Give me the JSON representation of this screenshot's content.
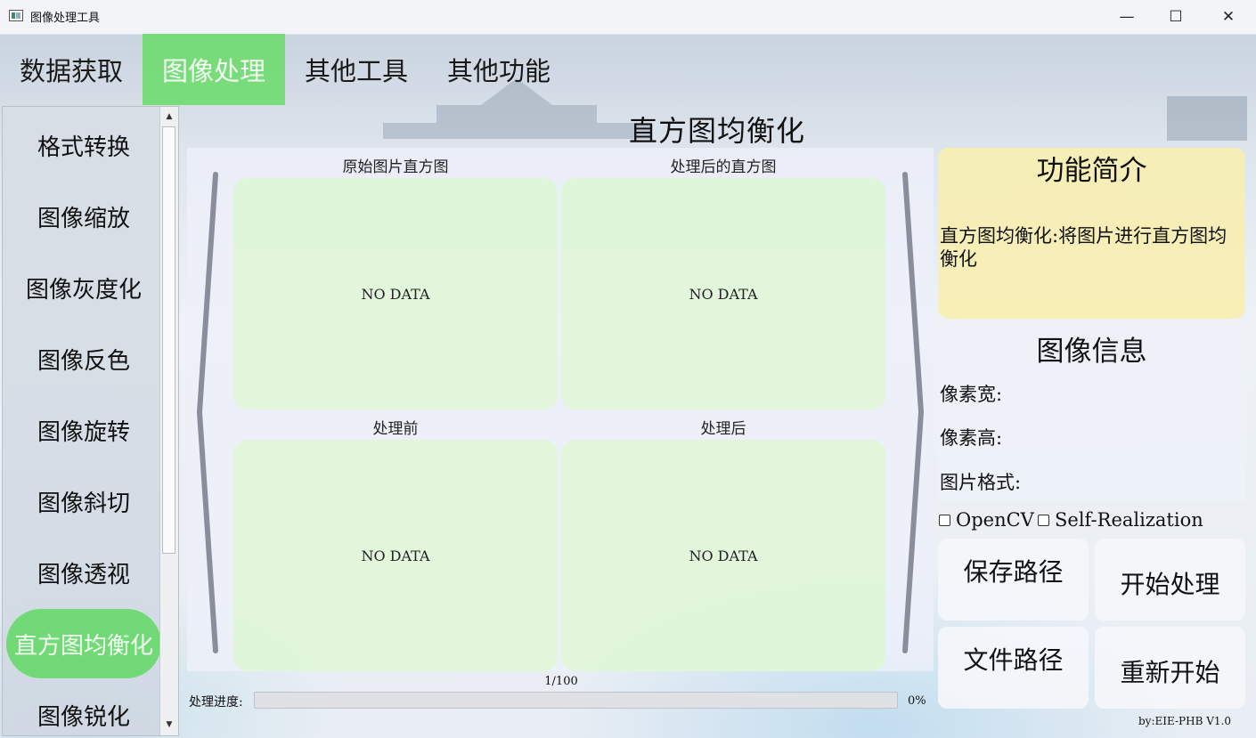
{
  "window": {
    "title": "图像处理工具",
    "minimize_glyph": "—",
    "maximize_glyph": "☐",
    "close_glyph": "✕"
  },
  "top_nav": {
    "tabs": [
      {
        "label": "数据获取",
        "active": false
      },
      {
        "label": "图像处理",
        "active": true
      },
      {
        "label": "其他工具",
        "active": false
      },
      {
        "label": "其他功能",
        "active": false
      }
    ]
  },
  "sidebar": {
    "items": [
      {
        "label": "格式转换",
        "active": false
      },
      {
        "label": "图像缩放",
        "active": false
      },
      {
        "label": "图像灰度化",
        "active": false
      },
      {
        "label": "图像反色",
        "active": false
      },
      {
        "label": "图像旋转",
        "active": false
      },
      {
        "label": "图像斜切",
        "active": false
      },
      {
        "label": "图像透视",
        "active": false
      },
      {
        "label": "直方图均衡化",
        "active": true
      },
      {
        "label": "图像锐化",
        "active": false
      }
    ],
    "scroll_up_glyph": "▲",
    "scroll_down_glyph": "▼"
  },
  "main": {
    "title": "直方图均衡化",
    "panels": {
      "original_hist": {
        "label": "原始图片直方图",
        "content": "NO DATA"
      },
      "processed_hist": {
        "label": "处理后的直方图",
        "content": "NO DATA"
      },
      "before": {
        "label": "处理前",
        "content": "NO DATA"
      },
      "after": {
        "label": "处理后",
        "content": "NO DATA"
      }
    },
    "progress": {
      "count": "1/100",
      "label": "处理进度:",
      "percent_text": "0%",
      "percent": 0
    }
  },
  "right_panel": {
    "intro_title": "功能简介",
    "intro_text": "直方图均衡化:将图片进行直方图均衡化",
    "info_title": "图像信息",
    "width_label": "像素宽:",
    "height_label": "像素高:",
    "format_label": "图片格式:",
    "opencv_label": "OpenCV",
    "opencv_checked": false,
    "self_label": "Self-Realization",
    "self_checked": false,
    "buttons": {
      "save_path": "保存路径",
      "start": "开始处理",
      "file_path": "文件路径",
      "restart": "重新开始"
    }
  },
  "footer": "by:EIE-PHB V1.0",
  "colors": {
    "accent_green": "#72d977",
    "panel_green": "#def7d6",
    "intro_yellow": "#f8eeb0"
  }
}
